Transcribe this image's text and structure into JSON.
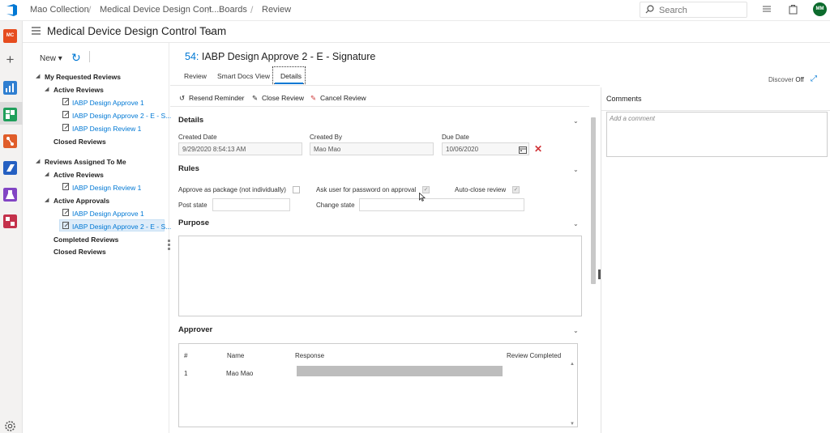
{
  "topbar": {
    "breadcrumbs": [
      "Mao Collection",
      "Medical Device Design Cont...",
      "Boards",
      "Review"
    ],
    "search_placeholder": "Search",
    "avatar_initials": "MM"
  },
  "rail": {
    "project_initials": "MC",
    "project_color": "#e64c1e"
  },
  "team": {
    "title": "Medical Device Design Control Team"
  },
  "tree": {
    "new_label": "New",
    "my_requested": "My Requested Reviews",
    "active_reviews": "Active Reviews",
    "req_items": [
      "IABP Design Approve 1",
      "IABP Design Approve 2 - E - S...",
      "IABP Design Review 1"
    ],
    "closed_reviews": "Closed Reviews",
    "assigned_to_me": "Reviews Assigned To Me",
    "assigned_active_reviews": "Active Reviews",
    "assigned_review_item": "IABP Design Review 1",
    "active_approvals": "Active Approvals",
    "approval_items": [
      "IABP Design Approve 1",
      "IABP Design Approve 2 - E - S..."
    ],
    "completed_reviews": "Completed Reviews",
    "assigned_closed_reviews": "Closed Reviews"
  },
  "review": {
    "id": "54:",
    "title": "IABP Design Approve 2 - E - Signature",
    "tabs": [
      "Review",
      "Smart Docs View",
      "Details"
    ],
    "active_tab": "Details",
    "actions": [
      "Resend Reminder",
      "Close Review",
      "Cancel Review"
    ]
  },
  "details": {
    "heading": "Details",
    "created_date_label": "Created Date",
    "created_date": "9/29/2020 8:54:13 AM",
    "created_by_label": "Created By",
    "created_by": "Mao Mao",
    "due_date_label": "Due Date",
    "due_date": "10/06/2020"
  },
  "rules": {
    "heading": "Rules",
    "approve_package_label": "Approve as package (not individually)",
    "approve_package_checked": false,
    "ask_password_label": "Ask user for password on approval",
    "ask_password_checked": true,
    "auto_close_label": "Auto-close review",
    "auto_close_checked": true,
    "post_state_label": "Post state",
    "post_state": "",
    "change_state_label": "Change state",
    "change_state": ""
  },
  "purpose": {
    "heading": "Purpose",
    "text": ""
  },
  "approver": {
    "heading": "Approver",
    "columns": [
      "#",
      "Name",
      "Response",
      "Review Completed"
    ],
    "rows": [
      {
        "num": "1",
        "name": "Mao Mao",
        "response": "",
        "completed": ""
      }
    ]
  },
  "discover": {
    "label": "Discover",
    "state": "Off"
  },
  "comments": {
    "title": "Comments",
    "placeholder": "Add a comment"
  }
}
